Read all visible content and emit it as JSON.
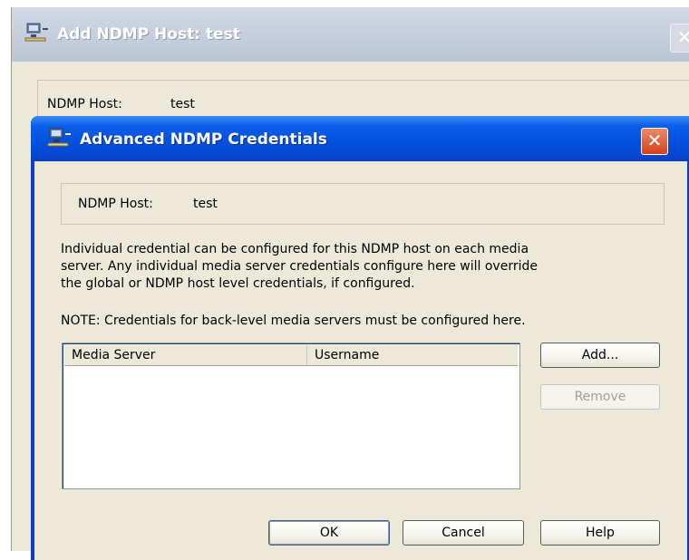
{
  "outer_window": {
    "title": "Add NDMP Host: test",
    "close_label": "✕",
    "host_label": "NDMP Host:",
    "host_value": "test"
  },
  "dialog": {
    "title": "Advanced NDMP Credentials",
    "close_label": "✕",
    "host_label": "NDMP Host:",
    "host_value": "test",
    "description_lines": [
      "Individual credential can be configured for this NDMP host on each media",
      "server.  Any individual media server credentials configure here will override",
      "the global or NDMP host level credentials, if configured."
    ],
    "note": "NOTE: Credentials for back-level media servers must be configured here.",
    "table": {
      "columns": [
        "Media Server",
        "Username"
      ],
      "rows": []
    },
    "buttons": {
      "add": "Add...",
      "remove": "Remove",
      "ok": "OK",
      "cancel": "Cancel",
      "help": "Help"
    }
  },
  "icons": {
    "window_icon": "network-host-icon",
    "close": "close-icon"
  },
  "colors": {
    "title_bar_active": "#0451e0",
    "title_bar_inactive": "#c3cddb",
    "dialog_face": "#ece9d8",
    "close_button": "#d5411d"
  }
}
